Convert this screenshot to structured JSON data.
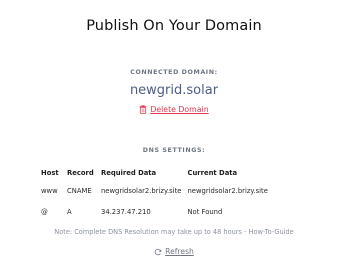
{
  "page": {
    "title": "Publish On Your Domain"
  },
  "connected": {
    "label": "CONNECTED DOMAIN:",
    "domain": "newgrid.solar",
    "delete_label": "Delete Domain",
    "delete_icon": "trash-icon"
  },
  "dns": {
    "label": "DNS SETTINGS:",
    "headers": [
      "Host",
      "Record",
      "Required Data",
      "Current Data"
    ],
    "rows": [
      {
        "host": "www",
        "record": "CNAME",
        "required": "newgridsolar2.brizy.site",
        "current": "newgridsolar2.brizy.site",
        "status": "ok"
      },
      {
        "host": "@",
        "record": "A",
        "required": "34.237.47.210",
        "current": "Not Found",
        "status": "not-found"
      }
    ],
    "status_colors": {
      "ok": "#159c25",
      "not-found": "#e4364f"
    }
  },
  "note": "Note: Complete DNS Resolution may take up to 48 hours - How-To-Guide",
  "refresh": {
    "label": "Refresh",
    "icon": "refresh-icon"
  }
}
